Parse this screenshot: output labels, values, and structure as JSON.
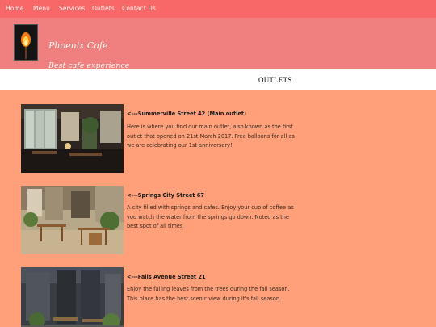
{
  "nav": {
    "items": [
      "Home",
      "Menu",
      "Services",
      "Outlets",
      "Contact Us"
    ]
  },
  "hero": {
    "brand": "Phoenix Cafe",
    "tagline": "Best cafe experience"
  },
  "section": {
    "title": "OUTLETS"
  },
  "outlets": [
    {
      "title": "<---Summerville Street 42 (Main outlet)",
      "description": "Here is where you find our main outlet, also known as the first outlet that opened on 21st March 2017. Free balloons for all as we are celebrating our 1st anniversary!"
    },
    {
      "title": "<---Springs City Street 67",
      "description": "A city filled with springs and cafes. Enjoy your cup of coffee as you watch the water from the springs go down. Noted as the best spot of all times"
    },
    {
      "title": "<---Falls Avenue Street 21",
      "description": "Enjoy the falling leaves from the trees during the fall season. This place has the best scenic view during it's fall season."
    }
  ],
  "colors": {
    "page_bg": "#ffa07a",
    "nav_bg": "#f86868",
    "hero_bg": "#f08080",
    "bar_bg": "#ffffff"
  }
}
